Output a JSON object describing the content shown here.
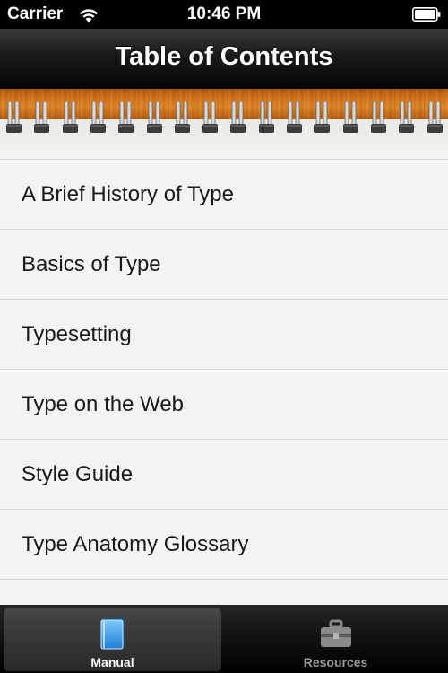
{
  "status_bar": {
    "carrier": "Carrier",
    "time": "10:46 PM",
    "wifi_icon": "wifi-icon",
    "battery_icon": "battery-icon"
  },
  "nav_bar": {
    "title": "Table of Contents"
  },
  "toc": {
    "items": [
      {
        "label": "A Brief History of Type"
      },
      {
        "label": "Basics of Type"
      },
      {
        "label": "Typesetting"
      },
      {
        "label": "Type on the Web"
      },
      {
        "label": "Style Guide"
      },
      {
        "label": "Type Anatomy Glossary"
      }
    ]
  },
  "tab_bar": {
    "tabs": [
      {
        "label": "Manual",
        "icon": "book-icon",
        "selected": true
      },
      {
        "label": "Resources",
        "icon": "toolbox-icon",
        "selected": false
      }
    ]
  },
  "colors": {
    "wood": "#d7781f",
    "paper": "#f3f3f1",
    "selected_tab_icon": "#3aa0e6"
  }
}
